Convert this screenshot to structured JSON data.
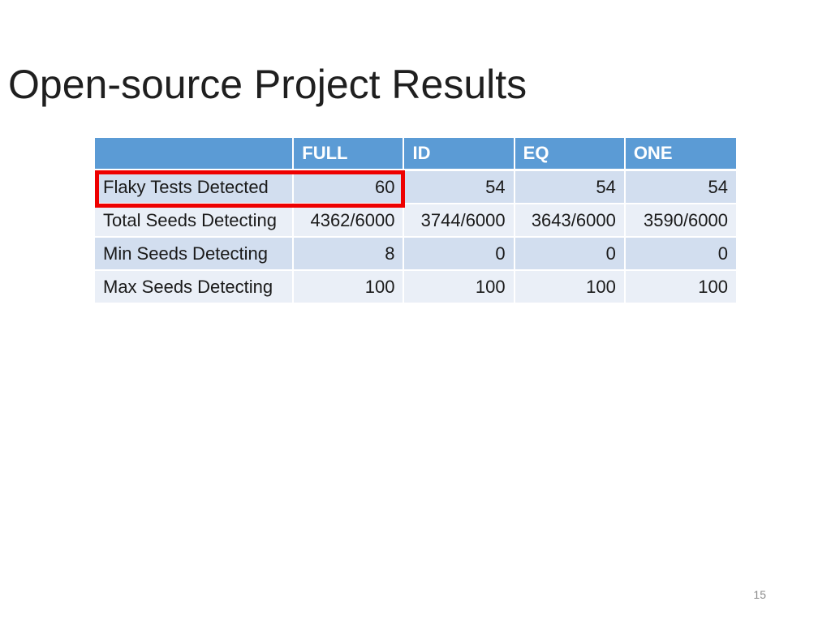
{
  "slide": {
    "title": "Open-source Project Results",
    "page_number": "15"
  },
  "table": {
    "header": [
      "",
      "FULL",
      "ID",
      "EQ",
      "ONE"
    ],
    "rows": [
      {
        "label": "Flaky Tests Detected",
        "values": [
          "60",
          "54",
          "54",
          "54"
        ]
      },
      {
        "label": "Total Seeds Detecting",
        "values": [
          "4362/6000",
          "3744/6000",
          "3643/6000",
          "3590/6000"
        ]
      },
      {
        "label": "Min Seeds Detecting",
        "values": [
          "8",
          "0",
          "0",
          "0"
        ]
      },
      {
        "label": "Max Seeds Detecting",
        "values": [
          "100",
          "100",
          "100",
          "100"
        ]
      }
    ]
  },
  "colors": {
    "header_bg": "#5b9bd5",
    "row_dark_bg": "#d2deef",
    "row_light_bg": "#eaeff7",
    "highlight": "#ee0000"
  }
}
